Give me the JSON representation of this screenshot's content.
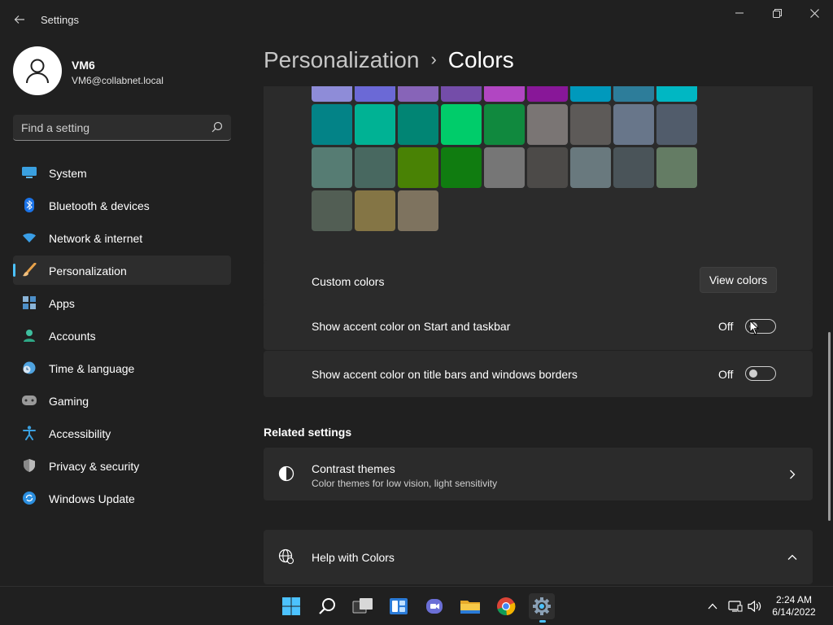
{
  "window": {
    "title": "Settings",
    "back_icon": "arrow-left-icon",
    "controls": [
      "minimize-icon",
      "restore-icon",
      "close-icon"
    ]
  },
  "user": {
    "name": "VM6",
    "email": "VM6@collabnet.local"
  },
  "search": {
    "placeholder": "Find a setting"
  },
  "sidebar": {
    "items": [
      {
        "label": "System",
        "icon": "monitor-icon",
        "active": false
      },
      {
        "label": "Bluetooth & devices",
        "icon": "bluetooth-icon",
        "active": false
      },
      {
        "label": "Network & internet",
        "icon": "wifi-icon",
        "active": false
      },
      {
        "label": "Personalization",
        "icon": "brush-icon",
        "active": true
      },
      {
        "label": "Apps",
        "icon": "apps-icon",
        "active": false
      },
      {
        "label": "Accounts",
        "icon": "person-icon",
        "active": false
      },
      {
        "label": "Time & language",
        "icon": "clock-globe-icon",
        "active": false
      },
      {
        "label": "Gaming",
        "icon": "gamepad-icon",
        "active": false
      },
      {
        "label": "Accessibility",
        "icon": "accessibility-icon",
        "active": false
      },
      {
        "label": "Privacy & security",
        "icon": "shield-icon",
        "active": false
      },
      {
        "label": "Windows Update",
        "icon": "update-icon",
        "active": false
      }
    ]
  },
  "breadcrumb": {
    "parent": "Personalization",
    "separator": "›",
    "current": "Colors"
  },
  "accent_palette": {
    "rows": [
      [
        "#8e8cd8",
        "#6b69d6",
        "#8764b8",
        "#744da9",
        "#b146c2",
        "#881798",
        "#0099bc",
        "#2d7d9a",
        "#00b7c3"
      ],
      [
        "#038387",
        "#00b294",
        "#018574",
        "#00cc6a",
        "#10893e",
        "#7a7574",
        "#5d5a58",
        "#68768a",
        "#515c6b"
      ],
      [
        "#567c73",
        "#486860",
        "#498205",
        "#107c10",
        "#767676",
        "#4c4a48",
        "#69797e",
        "#4a5459",
        "#647c64"
      ],
      [
        "#525e54",
        "#847545",
        "#7e735f"
      ]
    ]
  },
  "custom_colors": {
    "label": "Custom colors",
    "button": "View colors"
  },
  "toggles": [
    {
      "label": "Show accent color on Start and taskbar",
      "state": "Off",
      "on": false
    },
    {
      "label": "Show accent color on title bars and windows borders",
      "state": "Off",
      "on": false
    }
  ],
  "related": {
    "title": "Related settings",
    "items": [
      {
        "title": "Contrast themes",
        "subtitle": "Color themes for low vision, light sensitivity",
        "icon": "contrast-icon",
        "chevron": "chevron-right-icon"
      }
    ]
  },
  "help": {
    "title": "Help with Colors",
    "icon": "globe-icon",
    "chevron": "chevron-up-icon"
  },
  "taskbar": {
    "apps": [
      "windows-start-icon",
      "search-icon",
      "task-view-icon",
      "widgets-icon",
      "teams-chat-icon",
      "file-explorer-icon",
      "chrome-icon",
      "settings-gear-icon"
    ],
    "tray": [
      "chevron-up-icon",
      "network-icon",
      "volume-icon"
    ],
    "time": "2:24 AM",
    "date": "6/14/2022"
  },
  "colors": {
    "background": "#202020",
    "card": "#2b2b2b",
    "accent": "#4cc2ff"
  }
}
